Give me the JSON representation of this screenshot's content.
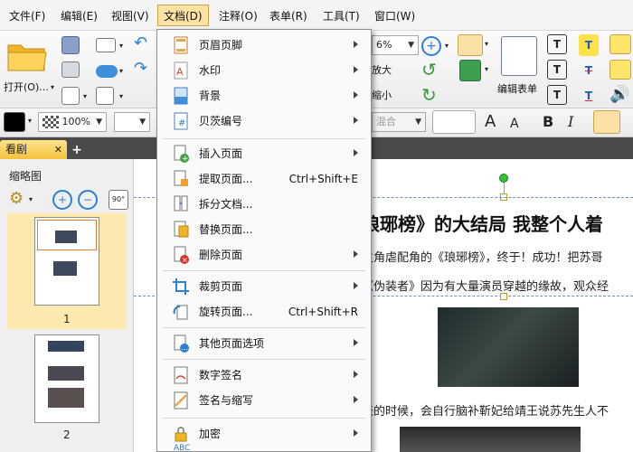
{
  "menubar": {
    "items": [
      "文件(F)",
      "编辑(E)",
      "视图(V)",
      "文档(D)",
      "注释(O)",
      "表单(R)",
      "工具(T)",
      "窗口(W)"
    ]
  },
  "toolbar": {
    "open_label": "打开(O)...",
    "zoom_value": "6%",
    "zoom_in_label": "放大",
    "zoom_out_label": "缩小",
    "edit_form_label": "编辑表单",
    "zoom_percent": "100%",
    "blend_mode": "混合"
  },
  "tabs": {
    "active_tab": "看剧"
  },
  "panel": {
    "title": "缩略图",
    "page_numbers": [
      "1",
      "2"
    ]
  },
  "document": {
    "title_line": "琅琊榜》的大结局 我整个人着",
    "line1": "主角虐配角的《琅琊榜》，终于！成功！把苏哥",
    "line2": "《伪装者》因为有大量演员穿越的缘故，观众经",
    "line3": "表的时候，会自行脑补靳妃给靖王说苏先生人不"
  },
  "dropdown": {
    "items": [
      {
        "label": "页眉页脚",
        "shortcut": "",
        "submenu": true,
        "icon": "header-footer-icon"
      },
      {
        "label": "水印",
        "shortcut": "",
        "submenu": true,
        "icon": "watermark-icon"
      },
      {
        "label": "背景",
        "shortcut": "",
        "submenu": true,
        "icon": "background-icon"
      },
      {
        "label": "贝茨编号",
        "shortcut": "",
        "submenu": true,
        "icon": "bates-number-icon"
      },
      {
        "label": "插入页面",
        "shortcut": "",
        "submenu": true,
        "icon": "insert-page-icon"
      },
      {
        "label": "提取页面...",
        "shortcut": "Ctrl+Shift+E",
        "submenu": false,
        "icon": "extract-page-icon"
      },
      {
        "label": "拆分文档...",
        "shortcut": "",
        "submenu": false,
        "icon": "split-document-icon"
      },
      {
        "label": "替换页面...",
        "shortcut": "",
        "submenu": false,
        "icon": "replace-page-icon"
      },
      {
        "label": "删除页面",
        "shortcut": "",
        "submenu": true,
        "icon": "delete-page-icon"
      },
      {
        "label": "裁剪页面",
        "shortcut": "",
        "submenu": true,
        "icon": "crop-page-icon"
      },
      {
        "label": "旋转页面...",
        "shortcut": "Ctrl+Shift+R",
        "submenu": false,
        "icon": "rotate-page-icon"
      },
      {
        "label": "其他页面选项",
        "shortcut": "",
        "submenu": true,
        "icon": "more-page-options-icon"
      },
      {
        "label": "数字签名",
        "shortcut": "",
        "submenu": true,
        "icon": "digital-signature-icon"
      },
      {
        "label": "签名与缩写",
        "shortcut": "",
        "submenu": true,
        "icon": "sign-initials-icon"
      },
      {
        "label": "加密",
        "shortcut": "",
        "submenu": true,
        "icon": "encrypt-icon"
      }
    ]
  },
  "colors": {
    "menu_active_bg": "#fbe1a4",
    "tab_bg": "#f3c23d",
    "accent_blue": "#2f7fd3"
  }
}
